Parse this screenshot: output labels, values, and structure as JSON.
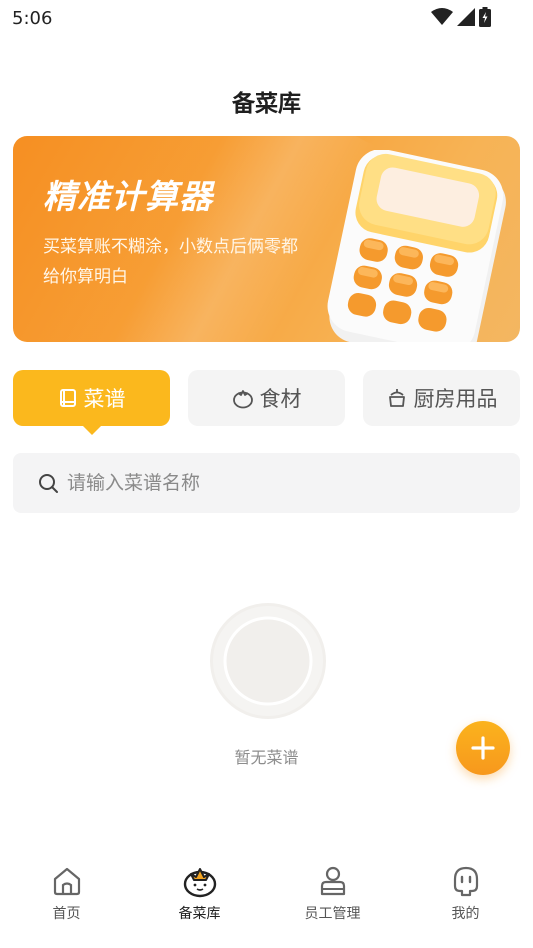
{
  "status_bar": {
    "time": "5:06"
  },
  "header": {
    "title": "备菜库"
  },
  "banner": {
    "title": "精准计算器",
    "subtitle": "买菜算账不糊涂，小数点后俩零都给你算明白"
  },
  "tabs": [
    {
      "label": "菜谱",
      "icon": "book-icon",
      "active": true
    },
    {
      "label": "食材",
      "icon": "tomato-icon",
      "active": false
    },
    {
      "label": "厨房用品",
      "icon": "pot-icon",
      "active": false
    }
  ],
  "search": {
    "placeholder": "请输入菜谱名称",
    "value": ""
  },
  "empty_state": {
    "text": "暂无菜谱"
  },
  "fab": {
    "icon": "plus-icon"
  },
  "bottom_nav": [
    {
      "label": "首页",
      "icon": "home-icon",
      "active": false
    },
    {
      "label": "备菜库",
      "icon": "tomato-icon",
      "active": true
    },
    {
      "label": "员工管理",
      "icon": "employee-icon",
      "active": false
    },
    {
      "label": "我的",
      "icon": "profile-icon",
      "active": false
    }
  ],
  "colors": {
    "accent": "#fbb81d",
    "banner_start": "#f68f22",
    "banner_end": "#f3b661"
  }
}
